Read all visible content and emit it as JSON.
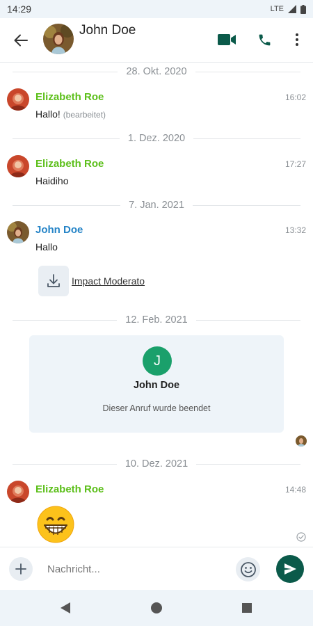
{
  "status_bar": {
    "time": "14:29",
    "network": "LTE"
  },
  "header": {
    "contact_name": "John Doe"
  },
  "colors": {
    "accent": "#0b5a4a",
    "elizabeth_name": "#5cbf1a",
    "john_name": "#2584c7",
    "call_avatar": "#1aa06b"
  },
  "messages": {
    "d1": {
      "date": "28. Okt. 2020",
      "sender": "Elizabeth Roe",
      "time": "16:02",
      "text": "Hallo!",
      "edited": "(bearbeitet)"
    },
    "d2": {
      "date": "1. Dez. 2020",
      "sender": "Elizabeth Roe",
      "time": "17:27",
      "text": "Haidiho"
    },
    "d3": {
      "date": "7. Jan. 2021",
      "sender": "John Doe",
      "time": "13:32",
      "text": "Hallo",
      "file_name": "Impact Moderato"
    },
    "d4": {
      "date": "12. Feb. 2021",
      "call_initial": "J",
      "call_name": "John Doe",
      "call_status": "Dieser Anruf wurde beendet"
    },
    "d5": {
      "date": "10. Dez. 2021",
      "sender": "Elizabeth Roe",
      "time": "14:48",
      "emoji": "grinning-face"
    }
  },
  "composer": {
    "placeholder": "Nachricht..."
  },
  "icons": {
    "back": "arrow-left-icon",
    "video": "video-camera-icon",
    "phone": "phone-icon",
    "more": "more-vert-icon",
    "add": "plus-icon",
    "emoji": "smiley-icon",
    "send": "send-icon",
    "download": "download-icon",
    "check": "check-circle-icon"
  },
  "nav_bar": {
    "buttons": [
      "back-triangle",
      "home-circle",
      "recents-square"
    ]
  }
}
